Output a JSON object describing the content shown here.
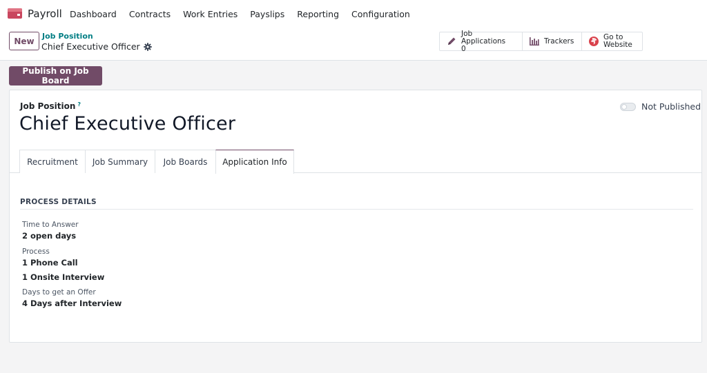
{
  "app": {
    "name": "Payroll",
    "brand_color": "#714b67",
    "logo_icon": "payroll-logo-icon"
  },
  "nav": {
    "items": [
      {
        "label": "Dashboard"
      },
      {
        "label": "Contracts"
      },
      {
        "label": "Work Entries"
      },
      {
        "label": "Payslips"
      },
      {
        "label": "Reporting"
      },
      {
        "label": "Configuration"
      }
    ]
  },
  "control": {
    "new_label": "New",
    "breadcrumb_parent": "Job Position",
    "breadcrumb_current": "Chief Executive Officer",
    "gear_icon": "gear-icon"
  },
  "smart_buttons": {
    "applications_label": "Job Applications",
    "applications_count": "0",
    "trackers_label": "Trackers",
    "website_line1": "Go to",
    "website_line2": "Website"
  },
  "actions": {
    "publish_label": "Publish on Job Board"
  },
  "form": {
    "field_label": "Job Position",
    "help_mark": "?",
    "title": "Chief Executive Officer",
    "publish_state": "Not Published"
  },
  "tabs": [
    {
      "label": "Recruitment"
    },
    {
      "label": "Job Summary"
    },
    {
      "label": "Job Boards"
    },
    {
      "label": "Application Info",
      "active": true
    }
  ],
  "process": {
    "section_title": "PROCESS DETAILS",
    "time_to_answer_label": "Time to Answer",
    "time_to_answer_value": "2 open days",
    "process_label": "Process",
    "process_step_1": "1 Phone Call",
    "process_step_2": "1 Onsite Interview",
    "offer_label": "Days to get an Offer",
    "offer_value": "4 Days after Interview"
  }
}
